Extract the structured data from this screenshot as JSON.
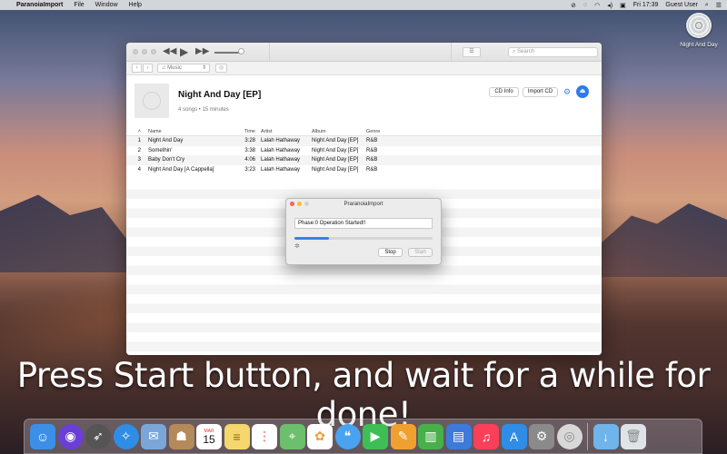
{
  "menubar": {
    "app_name": "ParanoiaImport",
    "items": [
      "File",
      "Window",
      "Help"
    ],
    "time": "Fri 17:39",
    "user": "Guest User"
  },
  "desktop": {
    "cd_label": "Night And Day"
  },
  "toolbar": {
    "search_placeholder": "Search"
  },
  "navbar": {
    "media_type": "Music"
  },
  "album": {
    "title": "Night And Day [EP]",
    "meta": "4 songs • 15 minutes",
    "cd_info_label": "CD Info",
    "import_label": "Import CD"
  },
  "table": {
    "columns": {
      "name": "Name",
      "time": "Time",
      "artist": "Artist",
      "album": "Album",
      "genre": "Genre"
    },
    "rows": [
      {
        "num": "1",
        "name": "Night And Day",
        "time": "3:28",
        "artist": "Lalah Hathaway",
        "album": "Night And Day [EP]",
        "genre": "R&B"
      },
      {
        "num": "2",
        "name": "Somethin'",
        "time": "3:38",
        "artist": "Lalah Hathaway",
        "album": "Night And Day [EP]",
        "genre": "R&B"
      },
      {
        "num": "3",
        "name": "Baby Don't Cry",
        "time": "4:06",
        "artist": "Lalah Hathaway",
        "album": "Night And Day [EP]",
        "genre": "R&B"
      },
      {
        "num": "4",
        "name": "Night And Day [A Cappella]",
        "time": "3:23",
        "artist": "Lalah Hathaway",
        "album": "Night And Day [EP]",
        "genre": "R&B"
      }
    ]
  },
  "dialog": {
    "title": "PraranoiaImport",
    "status": "Phase:0 Operation Started!!",
    "progress_fraction": 0.25,
    "stop_label": "Stop",
    "start_label": "Start"
  },
  "caption": "Press Start button, and wait for a while for done!",
  "dock": {
    "colors": {
      "finder": "#3b8fe6",
      "siri": "#6a3fd6",
      "launchpad": "#555",
      "safari": "#2f8de6",
      "mail": "#7aa7d8",
      "contacts": "#b58a5a",
      "calendar": "#ffffff",
      "notes": "#f5d76e",
      "reminders": "#ffffff",
      "maps": "#6cbf6c",
      "photos": "#ffffff",
      "messages": "#4aa3f0",
      "facetime": "#3dbf55",
      "pages": "#f0a030",
      "numbers": "#48b04a",
      "keynote": "#3d7ad9",
      "music": "#fa3f5a",
      "appstore": "#2f8de6",
      "prefs": "#8a8a8a",
      "cd": "#d8d8d8",
      "folder": "#6fb4ea",
      "trash": "#dfe3e8"
    },
    "calendar_month": "MAR",
    "calendar_day": "15"
  }
}
